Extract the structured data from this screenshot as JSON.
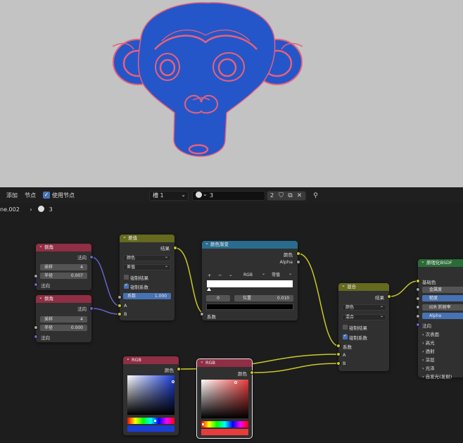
{
  "header": {
    "add_menu": "添加",
    "node_menu": "节点",
    "use_nodes_label": "使用节点",
    "slot_select": "槽 1",
    "material_name": "3",
    "user_count": "2"
  },
  "breadcrumb": {
    "object": "ne.002",
    "material": "3"
  },
  "nodes": {
    "bevel1": {
      "title": "倒角",
      "out_normal": "法向",
      "samples_label": "采样",
      "samples_value": "4",
      "radius_label": "半径",
      "radius_value": "0.007",
      "in_normal": "法向"
    },
    "bevel2": {
      "title": "倒角",
      "out_normal": "法向",
      "samples_label": "采样",
      "samples_value": "4",
      "radius_label": "半径",
      "radius_value": "0.000",
      "in_normal": "法向"
    },
    "diff": {
      "title": "差值",
      "out_result": "结果",
      "type": "颜色",
      "blend": "差值",
      "clamp_result": "钳制结果",
      "clamp_factor": "钳制系数",
      "factor_label": "系数",
      "factor_value": "1.000",
      "in_a": "A",
      "in_b": "B"
    },
    "ramp": {
      "title": "颜色渐变",
      "out_color": "颜色",
      "out_alpha": "Alpha",
      "add": "+",
      "remove": "−",
      "mode": "RGB",
      "interp": "常值",
      "stop_index": "0",
      "pos_label": "位置",
      "pos_value": "0.010",
      "in_fac": "系数"
    },
    "mix": {
      "title": "混合",
      "out_result": "结果",
      "type": "颜色",
      "blend": "混合",
      "clamp_result": "钳制结果",
      "clamp_factor": "钳制系数",
      "in_fac": "系数",
      "in_a": "A",
      "in_b": "B"
    },
    "bsdf": {
      "title": "原理化BSDF",
      "base_color": "基础色",
      "metallic": "金属度",
      "roughness": "糙度",
      "ior": "IOR 折射率",
      "alpha": "Alpha",
      "normal": "法向",
      "subsurface": "次表面",
      "specular": "高光",
      "transmission": "透射",
      "coat": "涂层",
      "sheen": "光泽",
      "emission": "自发光(发射)"
    },
    "rgb1": {
      "title": "RGB",
      "out_color": "颜色",
      "color": "#1a3dd6"
    },
    "rgb2": {
      "title": "RGB",
      "out_color": "颜色",
      "color": "#e83b3b"
    }
  },
  "colors": {
    "model_blue": "#2456c9",
    "model_rim": "#e8607a",
    "viewport_bg": "#c3c3c3"
  }
}
